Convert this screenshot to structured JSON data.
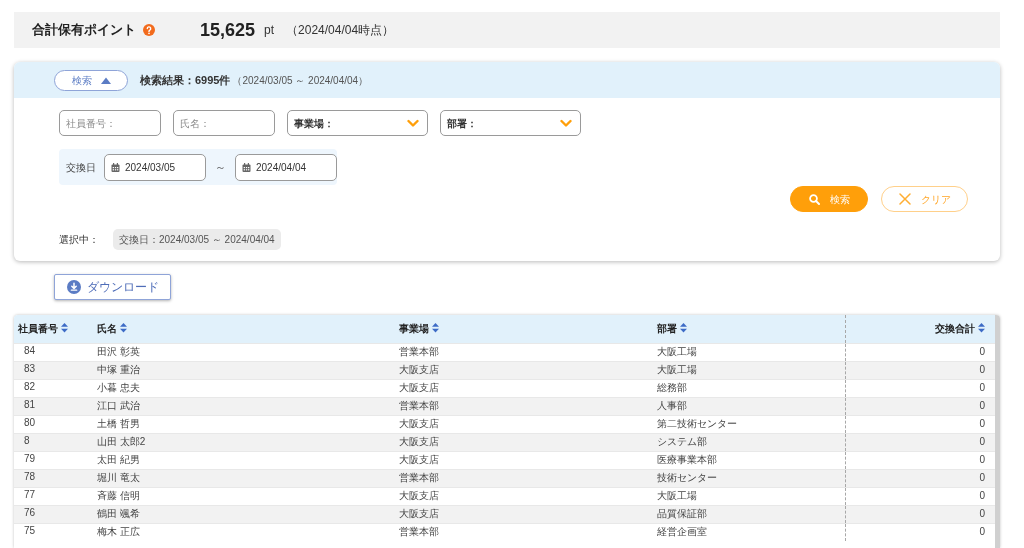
{
  "summary": {
    "label": "合計保有ポイント",
    "points": "15,625",
    "unit": "pt",
    "as_of": "（2024/04/04時点）"
  },
  "search": {
    "toggle": {
      "label": "検索",
      "expanded": true
    },
    "result": "検索結果：6995件",
    "range": "（2024/03/05 ～ 2024/04/04）",
    "fields": [
      {
        "kind": "text",
        "placeholder": "社員番号："
      },
      {
        "kind": "text",
        "placeholder": "氏名："
      },
      {
        "kind": "select",
        "label": "事業場："
      },
      {
        "kind": "select",
        "label": "部署："
      }
    ],
    "date_range": {
      "label": "交換日",
      "from": "2024/03/05",
      "separator": "～",
      "to": "2024/04/04"
    },
    "buttons": [
      {
        "kind": "primary",
        "label": "検索"
      },
      {
        "kind": "outline",
        "label": "クリア"
      }
    ],
    "selected": {
      "label": "選択中：",
      "chips": [
        "交換日：2024/03/05 ～ 2024/04/04"
      ]
    }
  },
  "download": {
    "label": "ダウンロード"
  },
  "table": {
    "columns": [
      "社員番号",
      "氏名",
      "事業場",
      "部署",
      "交換合計"
    ],
    "rows": [
      {
        "employee_no": "84",
        "name": "田沢 彰英",
        "site": "営業本部",
        "department": "大阪工場",
        "total": "0"
      },
      {
        "employee_no": "83",
        "name": "中塚 重治",
        "site": "大阪支店",
        "department": "大阪工場",
        "total": "0"
      },
      {
        "employee_no": "82",
        "name": "小暮 忠夫",
        "site": "大阪支店",
        "department": "総務部",
        "total": "0"
      },
      {
        "employee_no": "81",
        "name": "江口 武治",
        "site": "営業本部",
        "department": "人事部",
        "total": "0"
      },
      {
        "employee_no": "80",
        "name": "土橋 哲男",
        "site": "大阪支店",
        "department": "第二技術センター",
        "total": "0"
      },
      {
        "employee_no": "8",
        "name": "山田 太郎2",
        "site": "大阪支店",
        "department": "システム部",
        "total": "0"
      },
      {
        "employee_no": "79",
        "name": "太田 紀男",
        "site": "大阪支店",
        "department": "医療事業本部",
        "total": "0"
      },
      {
        "employee_no": "78",
        "name": "堀川 竜太",
        "site": "営業本部",
        "department": "技術センター",
        "total": "0"
      },
      {
        "employee_no": "77",
        "name": "斉藤 信明",
        "site": "大阪支店",
        "department": "大阪工場",
        "total": "0"
      },
      {
        "employee_no": "76",
        "name": "鶴田 颯希",
        "site": "大阪支店",
        "department": "品質保証部",
        "total": "0"
      },
      {
        "employee_no": "75",
        "name": "梅木 正広",
        "site": "営業本部",
        "department": "経営企画室",
        "total": "0"
      }
    ]
  }
}
